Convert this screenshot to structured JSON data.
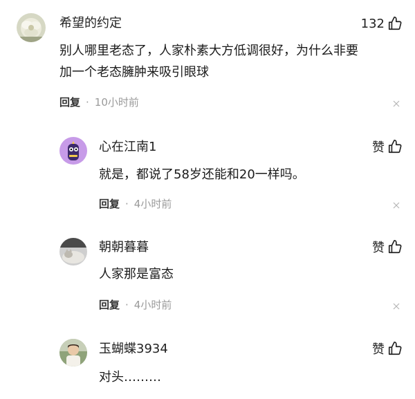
{
  "comments": [
    {
      "username": "希望的约定",
      "content_lines": [
        "别人哪里老态了，人家朴素大方低调很好，为什么非要",
        "加一个老态臃肿来吸引眼球"
      ],
      "like": "132",
      "reply": "回复",
      "time": "10小时前",
      "avatar_icon": "flower-avatar-icon"
    },
    {
      "username": "心在江南1",
      "content": "就是，都说了58岁还能和20一样吗。",
      "like": "赞",
      "reply": "回复",
      "time": "4小时前",
      "avatar_icon": "purple-cartoon-avatar-icon"
    },
    {
      "username": "朝朝暮暮",
      "content": "人家那是富态",
      "like": "赞",
      "reply": "回复",
      "time": "4小时前",
      "avatar_icon": "cat-photo-avatar-icon"
    },
    {
      "username": "玉蝴蝶3934",
      "content": "对头………",
      "like": "赞",
      "avatar_icon": "child-photo-avatar-icon"
    }
  ],
  "separator": "·",
  "colors": {
    "text": "#1b1b1b",
    "muted": "#9a9a9a",
    "purple_avatar": "#c79be8"
  }
}
